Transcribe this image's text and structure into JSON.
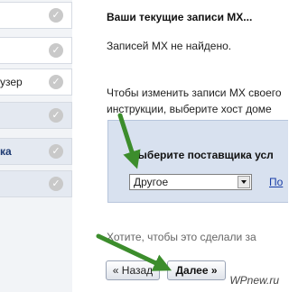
{
  "sidebar": {
    "items": [
      {
        "label": "",
        "active": false
      },
      {
        "label": "",
        "active": false
      },
      {
        "label": "узер",
        "active": false
      },
      {
        "label": "",
        "active": true
      },
      {
        "label": "ка",
        "active": true
      },
      {
        "label": "",
        "active": true
      }
    ]
  },
  "main": {
    "title": "Ваши текущие записи MX...",
    "no_records": "Записей MX не найдено.",
    "instructions_line1": "Чтобы изменить записи MX своего",
    "instructions_line2": "инструкции, выберите хост доме",
    "provider_label": "Выберите поставщика усл",
    "provider_select_value": "Другое",
    "help_link": "По",
    "footer_question": "Хотите, чтобы это сделали за",
    "back_button": "« Назад",
    "next_button": "Далее »"
  },
  "watermark": "WPnew.ru",
  "colors": {
    "arrow": "#3c8d2c",
    "panel": "#d8e1ef",
    "link": "#1a3ea8"
  }
}
